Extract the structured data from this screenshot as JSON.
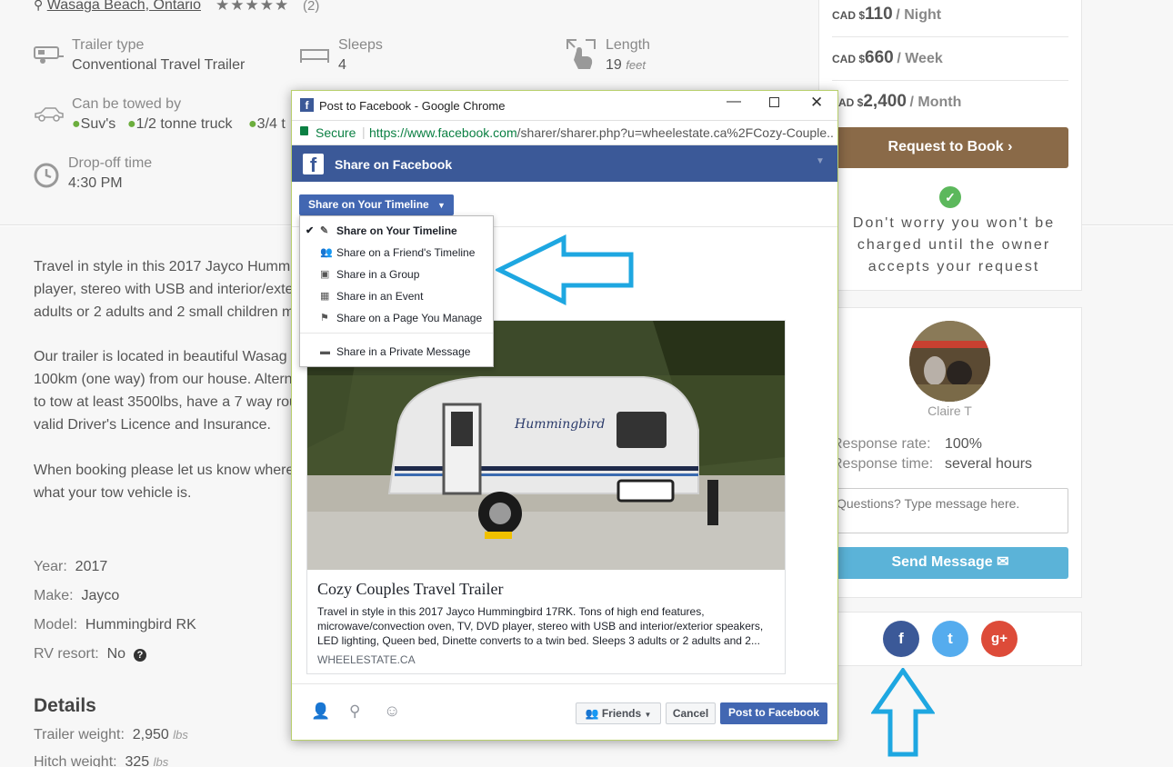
{
  "listing": {
    "location": "Wasaga Beach, Ontario",
    "rating_count": "(2)",
    "stars": "★★★★★"
  },
  "features": {
    "trailer_type_label": "Trailer type",
    "trailer_type_value": "Conventional Travel Trailer",
    "sleeps_label": "Sleeps",
    "sleeps_value": "4",
    "length_label": "Length",
    "length_value": "19",
    "length_unit": "feet",
    "towed_label": "Can be towed by",
    "towed_items": [
      "Suv's",
      "1/2 tonne truck",
      "3/4 t"
    ],
    "dropoff_label": "Drop-off time",
    "dropoff_value": "4:30 PM"
  },
  "description": {
    "p1": [
      "Travel in style in this 2017 Jayco Humm",
      "player, stereo with USB and interior/exte",
      "adults or 2 adults and 2 small children m"
    ],
    "p2": [
      "Our trailer is located in beautiful Wasag",
      "100km (one way) from our house. Altern",
      "to tow at least 3500lbs, have a 7 way rou",
      "valid Driver's Licence and Insurance."
    ],
    "p3": [
      "When booking please let us know where",
      "what your tow vehicle is."
    ]
  },
  "specs": {
    "year_k": "Year:",
    "year_v": "2017",
    "make_k": "Make:",
    "make_v": "Jayco",
    "model_k": "Model:",
    "model_v": "Hummingbird RK",
    "resort_k": "RV resort:",
    "resort_v": "No",
    "details_heading": "Details",
    "weight_k": "Trailer weight:",
    "weight_v": "2,950",
    "weight_u": "lbs",
    "hitch_k": "Hitch weight:",
    "hitch_v": "325",
    "hitch_u": "lbs"
  },
  "pricing": {
    "currency_prefix": "CAD $",
    "night_amount": "110",
    "night_unit": "/ Night",
    "week_amount": "660",
    "week_unit": "/ Week",
    "month_currency": "AD $",
    "month_amount": "2,400",
    "month_unit": "/ Month",
    "request_label": "Request to Book",
    "note_lines": [
      "Don't worry you won't be",
      "charged until the owner",
      "accepts your request"
    ]
  },
  "host": {
    "name": "Claire T",
    "response_rate_label": "Response rate:",
    "response_rate_value": "100%",
    "response_time_label": "Response time:",
    "response_time_value": "several hours",
    "message_placeholder": "Questions? Type message here.",
    "send_label": "Send Message"
  },
  "share": {
    "facebook": "f",
    "twitter": "t",
    "google": "g+"
  },
  "popup": {
    "window_title": "Post to Facebook - Google Chrome",
    "secure_label": "Secure",
    "url_host": "https://www.facebook.com",
    "url_path": "/sharer/sharer.php?u=wheelestate.ca%2FCozy-Couple...",
    "header_title": "Share on Facebook",
    "selector_label": "Share on Your Timeline",
    "menu": [
      {
        "label": "Share on Your Timeline",
        "icon": "edit-icon"
      },
      {
        "label": "Share on a Friend's Timeline",
        "icon": "friends-icon"
      },
      {
        "label": "Share in a Group",
        "icon": "group-icon"
      },
      {
        "label": "Share in an Event",
        "icon": "calendar-icon"
      },
      {
        "label": "Share on a Page You Manage",
        "icon": "flag-icon"
      },
      {
        "label": "Share in a Private Message",
        "icon": "message-icon"
      }
    ],
    "card_title": "Cozy Couples Travel Trailer",
    "card_desc_lines": [
      "Travel in style in this 2017 Jayco Hummingbird 17RK. Tons of high end features,",
      "microwave/convection oven, TV, DVD player, stereo with USB and interior/exterior speakers,",
      "LED lighting, Queen bed, Dinette converts to a twin bed. Sleeps 3 adults or 2 adults and 2..."
    ],
    "card_domain": "WHEELESTATE.CA",
    "audience_label": "Friends",
    "cancel_label": "Cancel",
    "post_label": "Post to Facebook",
    "trailer_brand": "Hummingbird"
  },
  "colors": {
    "facebook": "#3b5998",
    "twitter": "#55acee",
    "google": "#dd4b39",
    "request_button": "#8a6a48",
    "send_button": "#5bb3d8",
    "arrow": "#1ea7e1"
  }
}
